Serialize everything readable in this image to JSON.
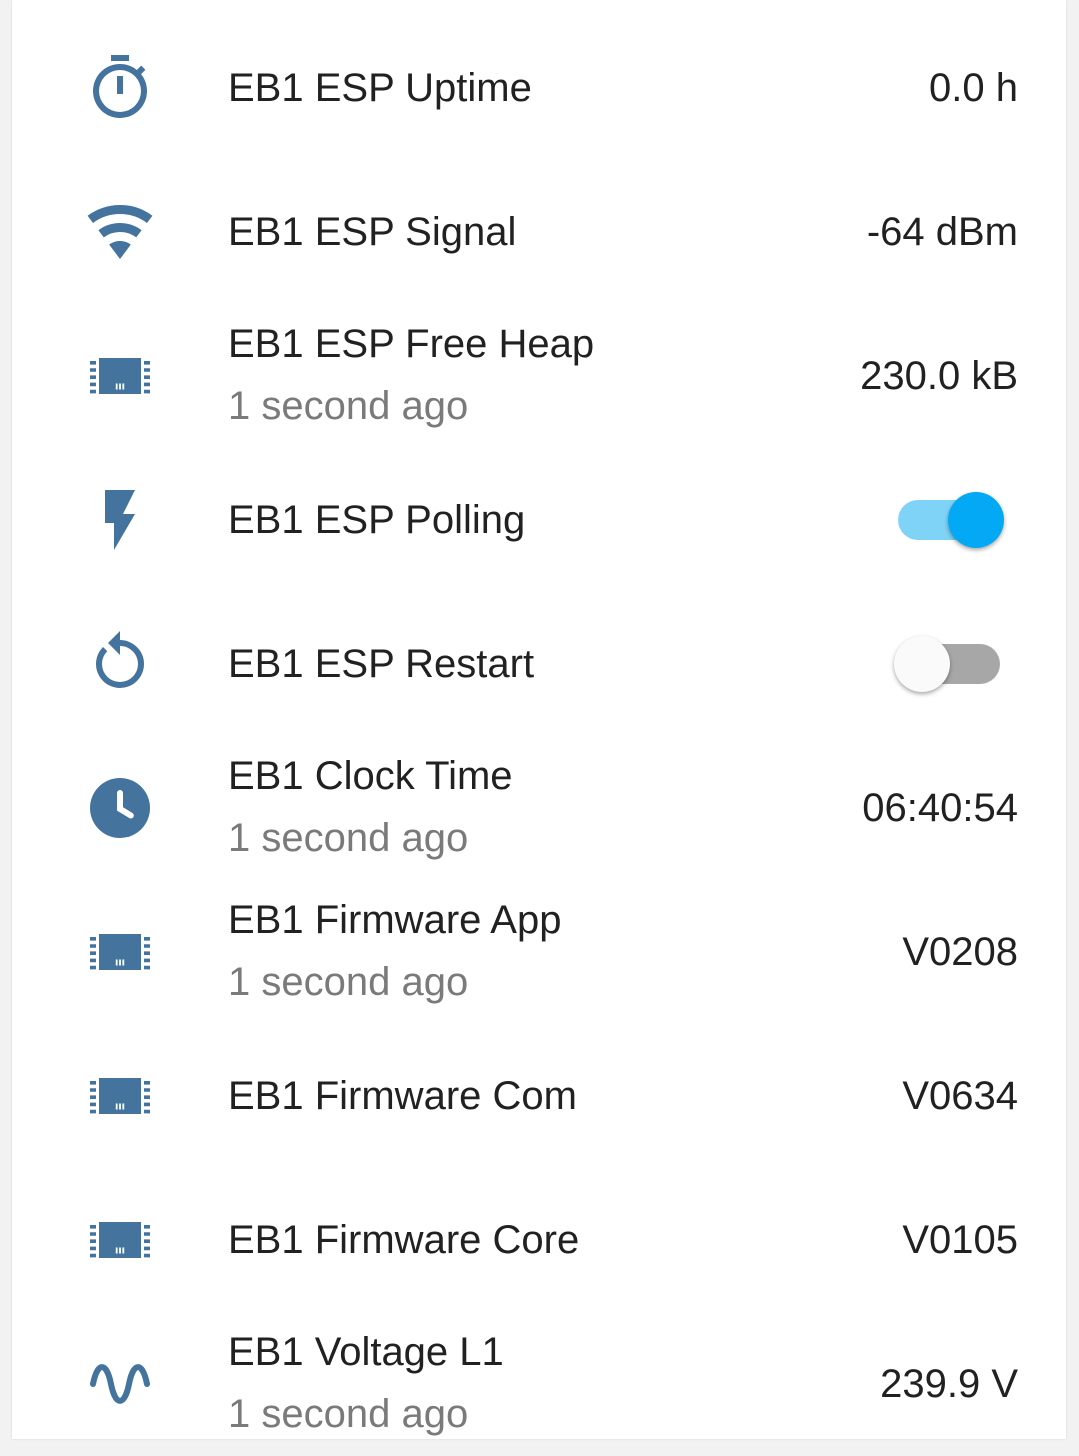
{
  "colors": {
    "icon": "#44739e",
    "toggle_on": "#03a9f4",
    "toggle_off_track": "#a7a7a7"
  },
  "rows": [
    {
      "icon": "timer-icon",
      "name": "EB1 ESP Uptime",
      "value": "0.0 h"
    },
    {
      "icon": "wifi-icon",
      "name": "EB1 ESP Signal",
      "value": "-64 dBm"
    },
    {
      "icon": "chip-icon",
      "name": "EB1 ESP Free Heap",
      "secondary": "1 second ago",
      "value": "230.0 kB"
    },
    {
      "icon": "flash-icon",
      "name": "EB1 ESP Polling",
      "toggle": "on"
    },
    {
      "icon": "restart-icon",
      "name": "EB1 ESP Restart",
      "toggle": "off"
    },
    {
      "icon": "clock-icon",
      "name": "EB1 Clock Time",
      "secondary": "1 second ago",
      "value": "06:40:54"
    },
    {
      "icon": "chip-icon",
      "name": "EB1 Firmware App",
      "secondary": "1 second ago",
      "value": "V0208"
    },
    {
      "icon": "chip-icon",
      "name": "EB1 Firmware Com",
      "value": "V0634"
    },
    {
      "icon": "chip-icon",
      "name": "EB1 Firmware Core",
      "value": "V0105"
    },
    {
      "icon": "sine-wave-icon",
      "name": "EB1 Voltage L1",
      "secondary": "1 second ago",
      "value": "239.9 V"
    }
  ]
}
